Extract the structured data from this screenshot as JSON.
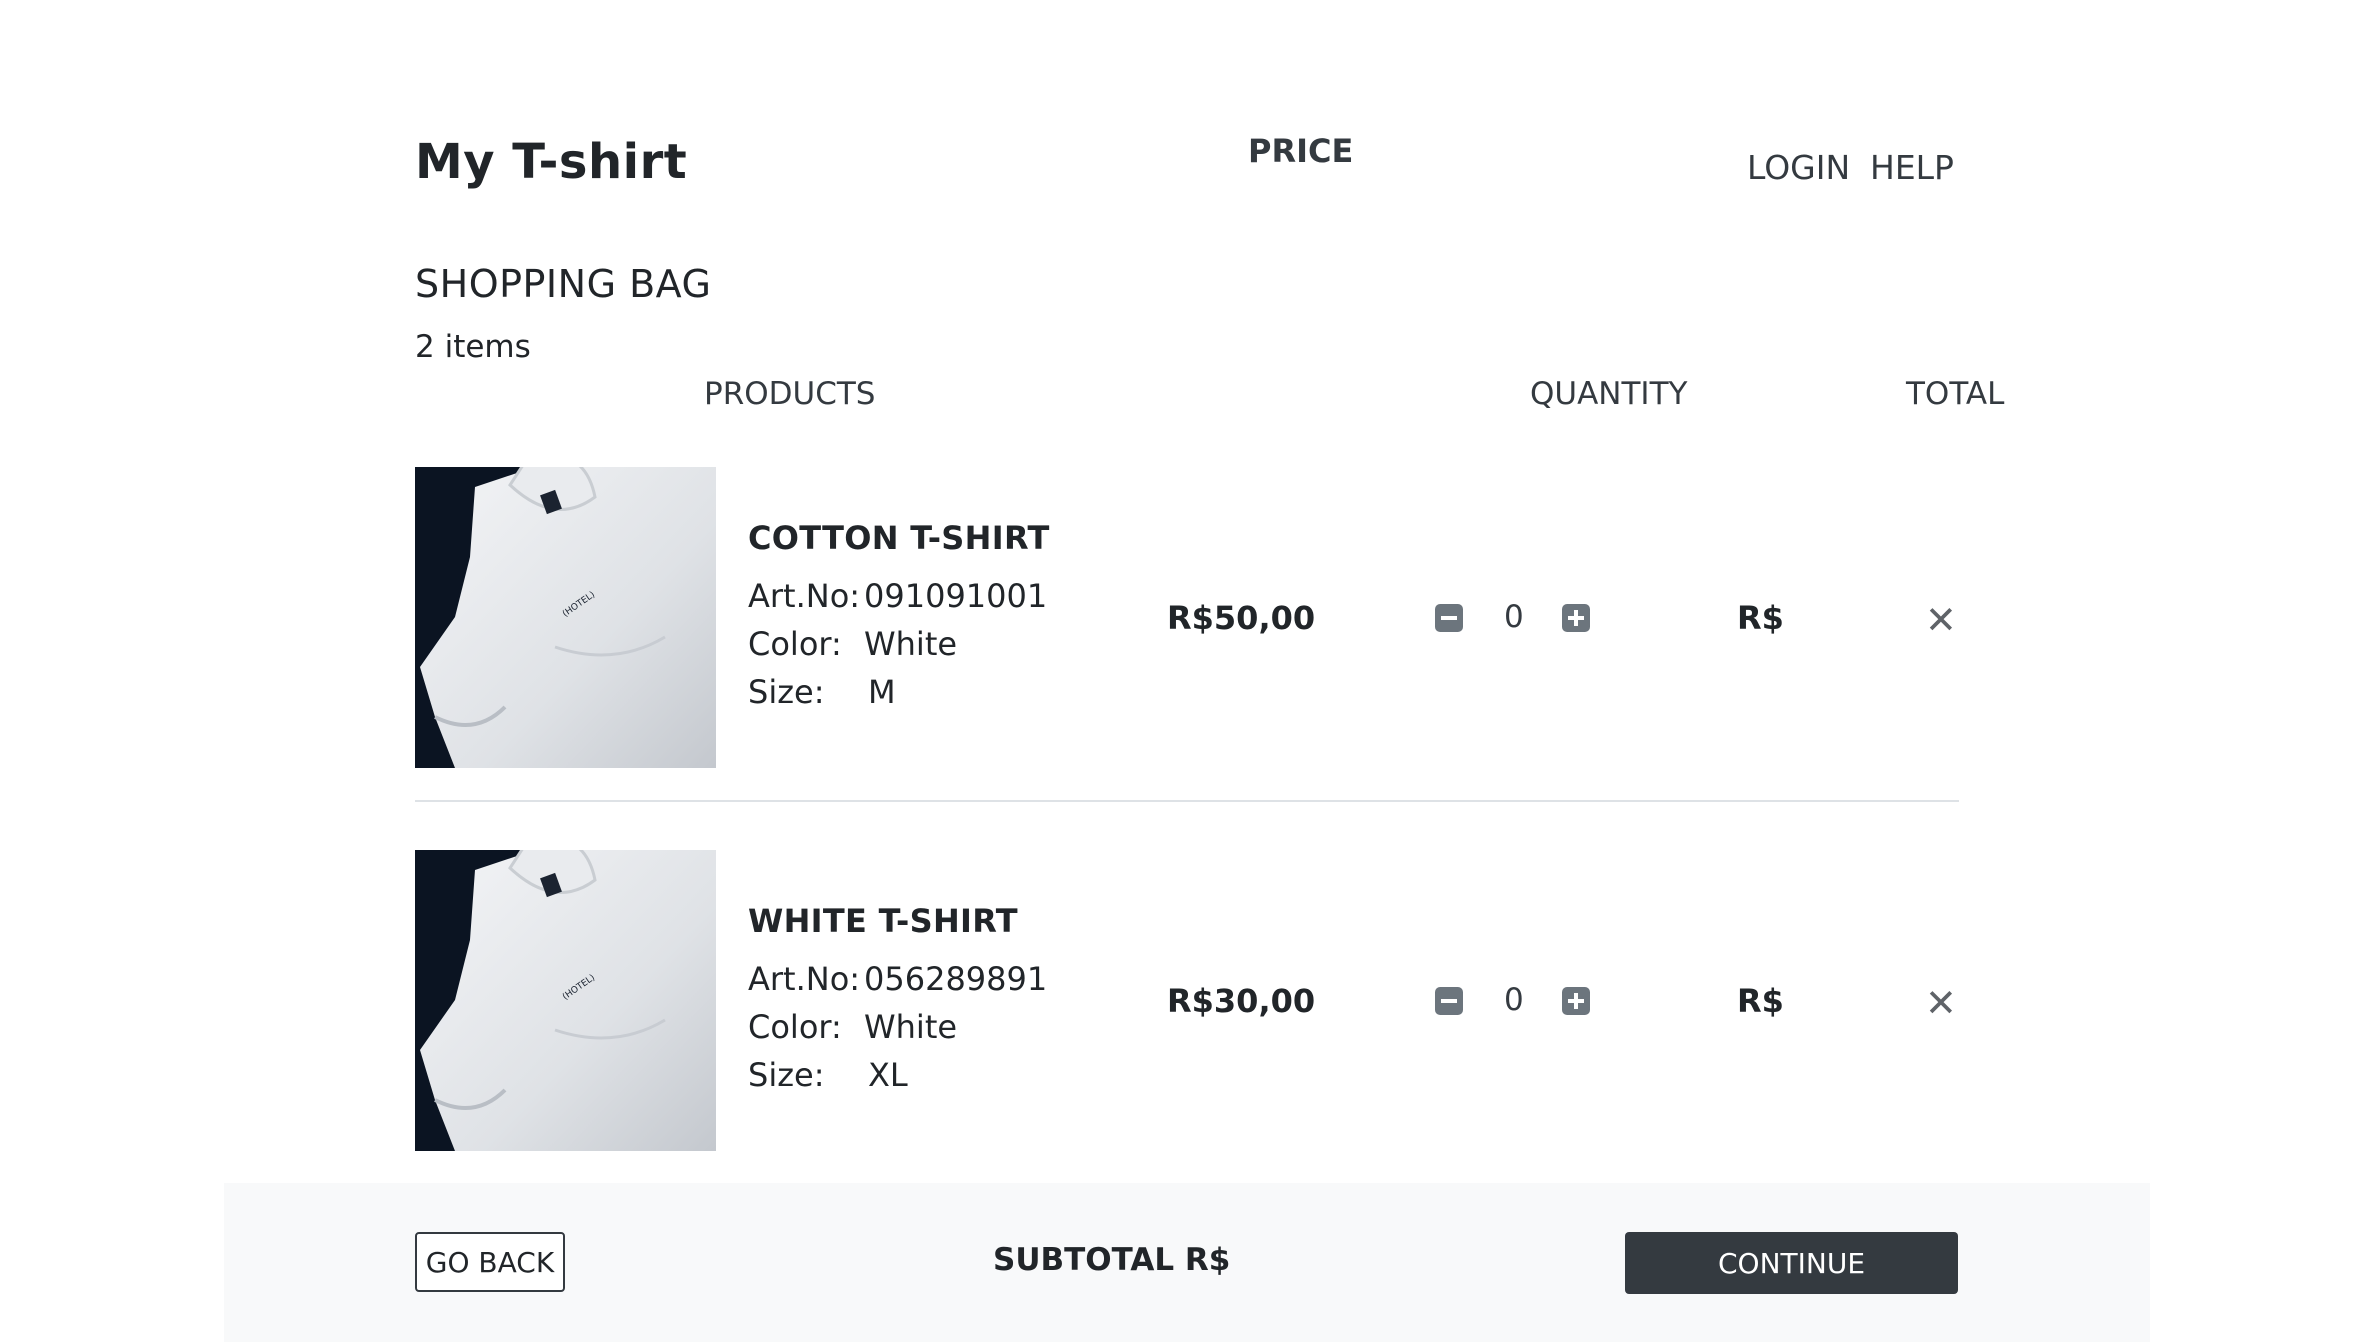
{
  "header": {
    "brand": "My T-shirt",
    "nav": {
      "login": "LOGIN",
      "help": "HELP"
    }
  },
  "bag": {
    "title": "SHOPPING BAG",
    "count": "2 items",
    "columns": {
      "products": "PRODUCTS",
      "price": "PRICE",
      "quantity": "QUANTITY",
      "total": "TOTAL"
    },
    "spec_labels": {
      "art": "Art.No:",
      "color": "Color:",
      "size": "Size:"
    },
    "items": [
      {
        "name": "COTTON T-SHIRT",
        "art_no": "091091001",
        "color": "White",
        "size": "M",
        "price": "R$50,00",
        "quantity": "0",
        "total": "R$",
        "image_label": "(HOTEL)"
      },
      {
        "name": "WHITE T-SHIRT",
        "art_no": "056289891",
        "color": "White",
        "size": "XL",
        "price": "R$30,00",
        "quantity": "0",
        "total": "R$",
        "image_label": "(HOTEL)"
      }
    ],
    "icons": {
      "decrease": "minus-square-icon",
      "increase": "plus-square-icon",
      "remove": "close-icon",
      "remove_glyph": "✕"
    }
  },
  "footer": {
    "go_back": "GO BACK",
    "subtotal": "SUBTOTAL R$",
    "continue": "CONTINUE"
  },
  "colors": {
    "text": "#212529",
    "button_dark": "#343a40",
    "icon_gray": "#6c757d",
    "footer_bg": "#f8f9fa",
    "divider": "#dee2e6"
  }
}
